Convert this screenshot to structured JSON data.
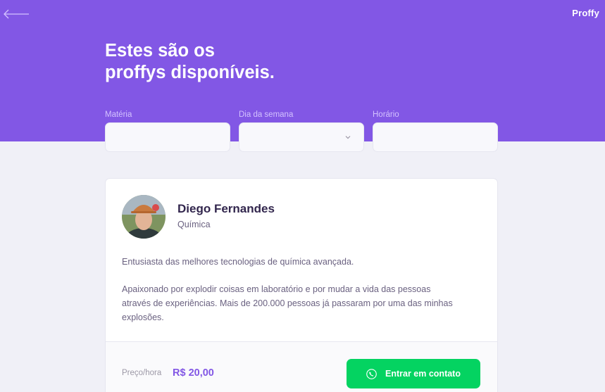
{
  "header": {
    "brand": "Proffy",
    "title_line1": "Estes são os",
    "title_line2": "proffys disponíveis."
  },
  "filters": {
    "subject_label": "Matéria",
    "subject_value": "",
    "weekday_label": "Dia da semana",
    "weekday_value": "",
    "time_label": "Horário",
    "time_value": ""
  },
  "teacher": {
    "name": "Diego Fernandes",
    "subject": "Química",
    "bio_paragraph_1": "Entusiasta das melhores tecnologias de química avançada.",
    "bio_paragraph_2": "Apaixonado por explodir coisas em laboratório e por mudar a vida das pessoas através de experiências. Mais de 200.000 pessoas já passaram por uma das minhas explosões.",
    "price_label": "Preço/hora",
    "price_value": "R$ 20,00",
    "contact_label": "Entrar em contato"
  },
  "colors": {
    "primary": "#8257E5",
    "accent_green": "#04D361",
    "background": "#F0F0F7",
    "title_text": "#32264D",
    "body_text": "#6A6180"
  },
  "icons": {
    "back": "arrow-left-icon",
    "chevron": "chevron-down-icon",
    "contact": "whatsapp-icon"
  }
}
